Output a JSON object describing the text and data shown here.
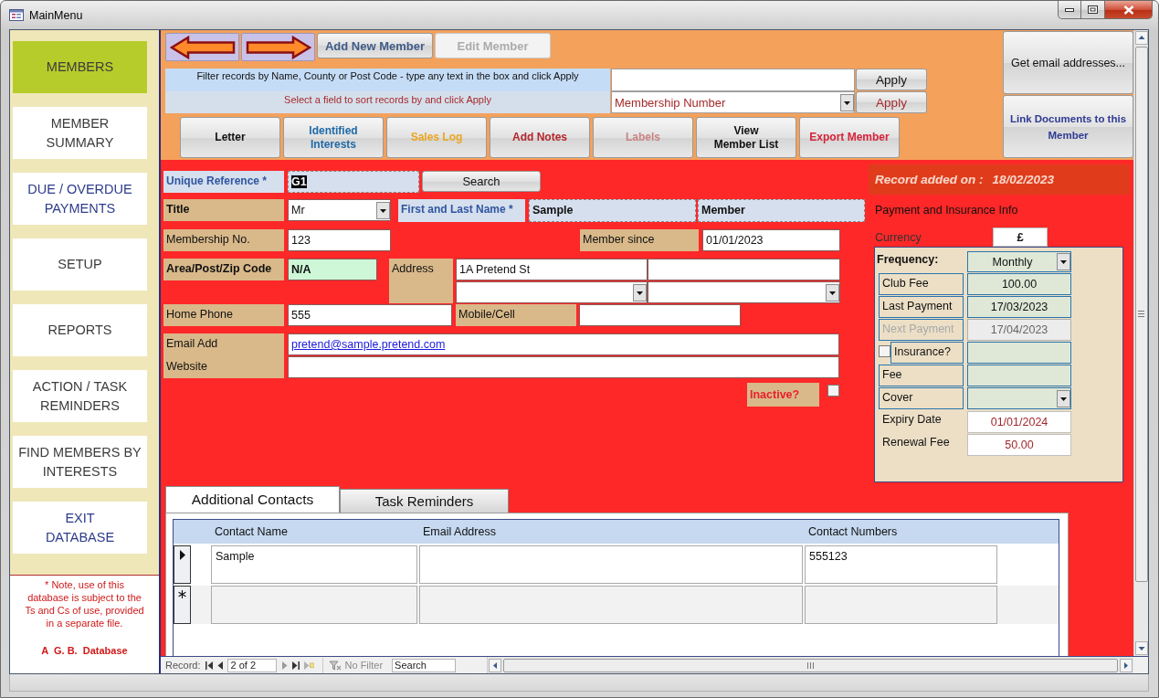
{
  "window": {
    "title": "MainMenu"
  },
  "sidebar": {
    "items": [
      {
        "label": "MEMBERS",
        "selected": true,
        "color": "#3c3c3c"
      },
      {
        "label": "MEMBER\nSUMMARY",
        "selected": false,
        "color": "#3c3c3c"
      },
      {
        "label": "DUE / OVERDUE\nPAYMENTS",
        "selected": false,
        "color": "#2e3c8c"
      },
      {
        "label": "SETUP",
        "selected": false,
        "color": "#3c3c3c"
      },
      {
        "label": "REPORTS",
        "selected": false,
        "color": "#3c3c3c"
      },
      {
        "label": "ACTION / TASK\nREMINDERS",
        "selected": false,
        "color": "#3c3c3c"
      },
      {
        "label": "FIND MEMBERS BY\nINTERESTS",
        "selected": false,
        "color": "#3c3c3c"
      },
      {
        "label": "EXIT\nDATABASE",
        "selected": false,
        "color": "#2e3c8c"
      }
    ],
    "note": "* Note, use of this\ndatabase is subject to the\nTs and Cs of use, provided\nin a separate file.",
    "footer": "A  G. B.  Database"
  },
  "header": {
    "member_buttons": [
      {
        "label": "Add New Member",
        "disabled": false
      },
      {
        "label": "Edit Member",
        "disabled": true
      }
    ],
    "filter": {
      "label": "Filter records by Name, County or Post Code - type any text in the box and click Apply",
      "apply": "Apply"
    },
    "sort": {
      "label": "Select a field to sort records by and click Apply",
      "value": "Membership Number",
      "apply": "Apply"
    },
    "actions": [
      {
        "label": "Letter",
        "color": "#111111"
      },
      {
        "label": "Identified\nInterests",
        "color": "#1f6aa8"
      },
      {
        "label": "Sales Log",
        "color": "#eaa620"
      },
      {
        "label": "Add Notes",
        "color": "#b3262b"
      },
      {
        "label": "Labels",
        "color": "#c98383"
      },
      {
        "label": "View\nMember List",
        "color": "#111111"
      },
      {
        "label": "Export Member",
        "color": "#d6233a"
      }
    ],
    "side_buttons": [
      {
        "label": "Get email addresses...",
        "color": "#111111"
      },
      {
        "label": "Link Documents to this\nMember",
        "color": "#2e3a94"
      }
    ]
  },
  "member": {
    "unique_reference": {
      "label": "Unique Reference *",
      "value": "G1",
      "text_selected": true,
      "search": "Search"
    },
    "title": {
      "label": "Title",
      "value": "Mr"
    },
    "name": {
      "label": "First and Last Name *",
      "first": "Sample",
      "last": "Member"
    },
    "membership_no": {
      "label": "Membership No.",
      "value": "123"
    },
    "member_since": {
      "label": "Member since",
      "value": "01/01/2023"
    },
    "postcode": {
      "label": "Area/Post/Zip Code",
      "value": "N/A"
    },
    "address": {
      "label": "Address",
      "line_1": "1A Pretend St"
    },
    "home_phone": {
      "label": "Home Phone",
      "value": "555"
    },
    "mobile": {
      "label": "Mobile/Cell"
    },
    "email": {
      "label": "Email Add",
      "value": "pretend@sample.pretend.com"
    },
    "website": {
      "label": "Website"
    },
    "inactive": {
      "label": "Inactive?",
      "checked": false
    }
  },
  "payment": {
    "record_added": {
      "label": "Record added on :",
      "date": "18/02/2023"
    },
    "heading": "Payment and Insurance Info",
    "currency": {
      "label": "Currency",
      "value": "£"
    },
    "frequency": {
      "label": "Frequency:",
      "value": "Monthly"
    },
    "fees": [
      {
        "label": "Club Fee",
        "value": "100.00",
        "disabled": false
      },
      {
        "label": "Last Payment",
        "value": "17/03/2023",
        "disabled": false
      },
      {
        "label": "Next Payment",
        "value": "17/04/2023",
        "disabled": true
      }
    ],
    "insurance": {
      "label": "Insurance?",
      "checked": false
    },
    "insurance_fields": [
      {
        "label": "Fee",
        "kind": "text"
      },
      {
        "label": "Cover",
        "kind": "dropdown"
      }
    ],
    "renewal": [
      {
        "label": "Expiry Date",
        "value": "01/01/2024"
      },
      {
        "label": "Renewal Fee",
        "value": "50.00"
      }
    ]
  },
  "tabs": [
    {
      "label": "Additional Contacts",
      "selected": true
    },
    {
      "label": "Task Reminders",
      "selected": false
    }
  ],
  "contacts": {
    "columns": [
      "Contact Name",
      "Email Address",
      "Contact Numbers"
    ],
    "rows": [
      {
        "kind": "record",
        "selected": true,
        "contact_name": "Sample",
        "contact_numbers": "555123"
      },
      {
        "kind": "new",
        "selected": false
      }
    ]
  },
  "record_nav": {
    "label": "Record:",
    "position": "2 of 2",
    "filter": "No Filter",
    "search": {
      "placeholder": "Search"
    }
  }
}
